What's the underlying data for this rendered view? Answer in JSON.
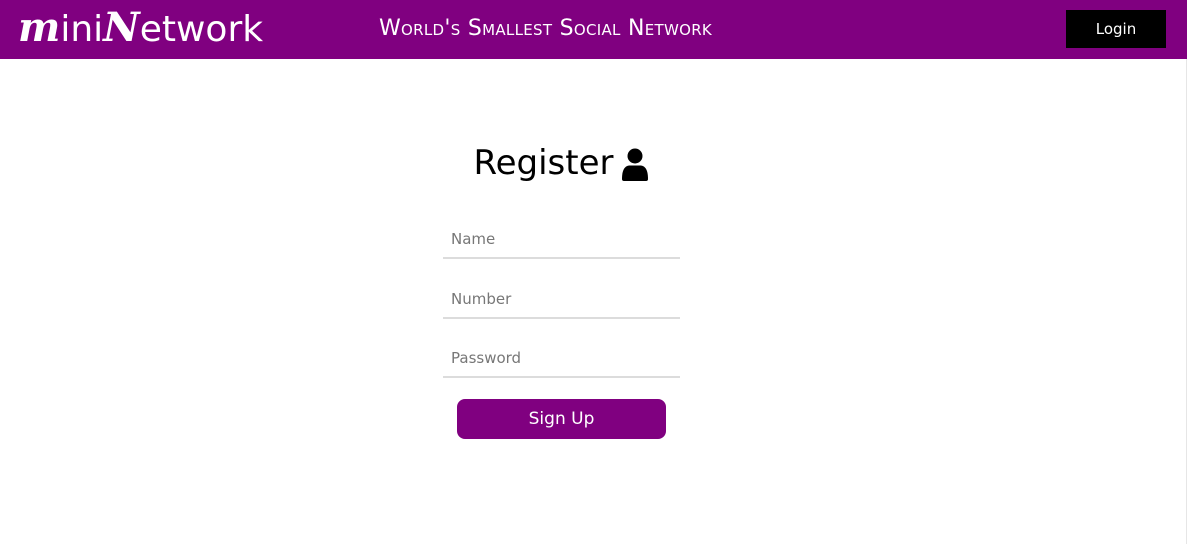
{
  "header": {
    "logo": {
      "part1_cap": "m",
      "part1_rest": "ini",
      "part2_cap": "N",
      "part2_rest": "etwork"
    },
    "tagline": "World's Smallest Social Network",
    "login_label": "Login",
    "bg_color": "#800080"
  },
  "register": {
    "title": "Register",
    "title_icon": "user-icon",
    "fields": {
      "name_placeholder": "Name",
      "number_placeholder": "Number",
      "password_placeholder": "Password"
    },
    "submit_label": "Sign Up",
    "accent_color": "#800080"
  }
}
